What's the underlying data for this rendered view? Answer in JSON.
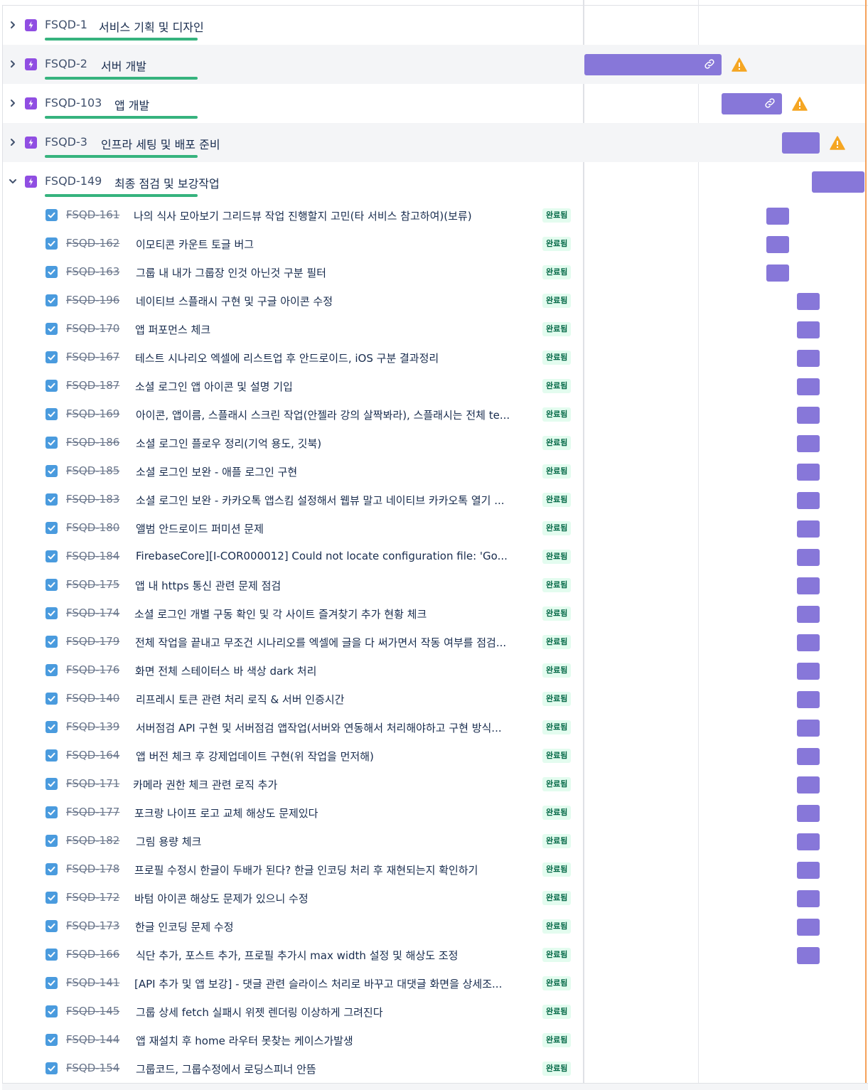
{
  "colors": {
    "epic_icon": "#904ee2",
    "progress": "#36b37e",
    "bar": "#8777d9",
    "checkbox": "#4a9bde",
    "status_bg": "#e3fcef",
    "status_text": "#006644",
    "warning": "#f5a623",
    "today_line": "#f5a15a"
  },
  "epics": [
    {
      "key": "FSQD-1",
      "summary": "서비스 기획 및 디자인",
      "expanded": false,
      "icon": "epic-lightning-icon",
      "has_bar": false,
      "has_link": false,
      "has_warning": false
    },
    {
      "key": "FSQD-2",
      "summary": "서버 개발",
      "expanded": false,
      "icon": "epic-lightning-icon",
      "has_bar": true,
      "has_link": true,
      "has_warning": true
    },
    {
      "key": "FSQD-103",
      "summary": "앱 개발",
      "expanded": false,
      "icon": "epic-lightning-icon",
      "has_bar": true,
      "has_link": true,
      "has_warning": true
    },
    {
      "key": "FSQD-3",
      "summary": "인프라 세팅 및 배포 준비",
      "expanded": false,
      "icon": "epic-lightning-icon",
      "has_bar": true,
      "has_link": false,
      "has_warning": true
    },
    {
      "key": "FSQD-149",
      "summary": "최종 점검 및 보강작업",
      "expanded": true,
      "icon": "epic-lightning-icon",
      "has_bar": true,
      "has_link": false,
      "has_warning": false
    }
  ],
  "children": [
    {
      "key": "FSQD-161",
      "summary": "나의 식사 모아보기 그리드뷰 작업 진행할지 고민(타 서비스 참고하여)(보류)",
      "status": "완료됨"
    },
    {
      "key": "FSQD-162",
      "summary": "이모티콘 카운트 토글 버그",
      "status": "완료됨"
    },
    {
      "key": "FSQD-163",
      "summary": "그룹 내 내가 그룹장 인것 아닌것 구분 필터",
      "status": "완료됨"
    },
    {
      "key": "FSQD-196",
      "summary": "네이티브 스플래시 구현 및 구글 아이콘 수정",
      "status": "완료됨"
    },
    {
      "key": "FSQD-170",
      "summary": "앱 퍼포먼스 체크",
      "status": "완료됨"
    },
    {
      "key": "FSQD-167",
      "summary": "테스트 시나리오 엑셀에 리스트업 후 안드로이드, iOS 구분 결과정리",
      "status": "완료됨"
    },
    {
      "key": "FSQD-187",
      "summary": "소셜 로그인 앱 아이콘 및 설명 기입",
      "status": "완료됨"
    },
    {
      "key": "FSQD-169",
      "summary": "아이콘, 앱이름, 스플래시 스크린 작업(안젤라 강의 살짝봐라), 스플래시는 전체 te...",
      "status": "완료됨"
    },
    {
      "key": "FSQD-186",
      "summary": "소셜 로그인 플로우 정리(기억 용도, 깃북)",
      "status": "완료됨"
    },
    {
      "key": "FSQD-185",
      "summary": "소셜 로그인 보완 - 애플 로그인 구현",
      "status": "완료됨"
    },
    {
      "key": "FSQD-183",
      "summary": "소셜 로그인 보완 - 카카오톡 앱스킴 설정해서 웹뷰 말고 네이티브 카카오톡 열기 ...",
      "status": "완료됨"
    },
    {
      "key": "FSQD-180",
      "summary": "앨범 안드로이드 퍼미션 문제",
      "status": "완료됨"
    },
    {
      "key": "FSQD-184",
      "summary": "FirebaseCore][I-COR000012] Could not locate configuration file: 'Go...",
      "status": "완료됨"
    },
    {
      "key": "FSQD-175",
      "summary": "앱 내 https 통신 관련 문제 점검",
      "status": "완료됨"
    },
    {
      "key": "FSQD-174",
      "summary": "소셜 로그인 개별 구동 확인 및 각 사이트 즐겨찾기 추가 현황 체크",
      "status": "완료됨"
    },
    {
      "key": "FSQD-179",
      "summary": "전체 작업을 끝내고 무조건 시나리오를 엑셀에 글을 다 써가면서 작동 여부를 점검...",
      "status": "완료됨"
    },
    {
      "key": "FSQD-176",
      "summary": "화면 전체 스테이터스 바 색상 dark 처리",
      "status": "완료됨"
    },
    {
      "key": "FSQD-140",
      "summary": "리프레시 토큰 관련 처리 로직 & 서버 인증시간",
      "status": "완료됨"
    },
    {
      "key": "FSQD-139",
      "summary": "서버점검 API 구현 및 서버점검 앱작업(서버와 연동해서 처리해야하고 구현 방식...",
      "status": "완료됨"
    },
    {
      "key": "FSQD-164",
      "summary": "앱 버전 체크 후 강제업데이트 구현(위 작업을 먼저해)",
      "status": "완료됨"
    },
    {
      "key": "FSQD-171",
      "summary": "카메라 권한 체크 관련 로직 추가",
      "status": "완료됨"
    },
    {
      "key": "FSQD-177",
      "summary": "포크랑 나이프 로고 교체 해상도 문제있다",
      "status": "완료됨"
    },
    {
      "key": "FSQD-182",
      "summary": "그림 용량 체크",
      "status": "완료됨"
    },
    {
      "key": "FSQD-178",
      "summary": "프로필 수정시 한글이 두배가 된다? 한글 인코딩 처리 후 재현되는지 확인하기",
      "status": "완료됨"
    },
    {
      "key": "FSQD-172",
      "summary": "바텀 아이콘 해상도 문제가 있으니 수정",
      "status": "완료됨"
    },
    {
      "key": "FSQD-173",
      "summary": "한글 인코딩 문제 수정",
      "status": "완료됨"
    },
    {
      "key": "FSQD-166",
      "summary": "식단 추가, 포스트 추가, 프로필 추가시 max width 설정 및 해상도 조정",
      "status": "완료됨"
    },
    {
      "key": "FSQD-141",
      "summary": "[API 추가 및 앱 보강] - 댓글 관련 슬라이스 처리로 바꾸고 대댓글 화면을 상세조...",
      "status": "완료됨"
    },
    {
      "key": "FSQD-145",
      "summary": "그룹 상세 fetch 실패시 위젯 렌더링 이상하게 그려진다",
      "status": "완료됨"
    },
    {
      "key": "FSQD-144",
      "summary": "앱 재설치 후 home 라우터 못찾는 케이스가발생",
      "status": "완료됨"
    },
    {
      "key": "FSQD-154",
      "summary": "그룹코드, 그룹수정에서 로딩스피너 안뜸",
      "status": "완료됨"
    }
  ]
}
